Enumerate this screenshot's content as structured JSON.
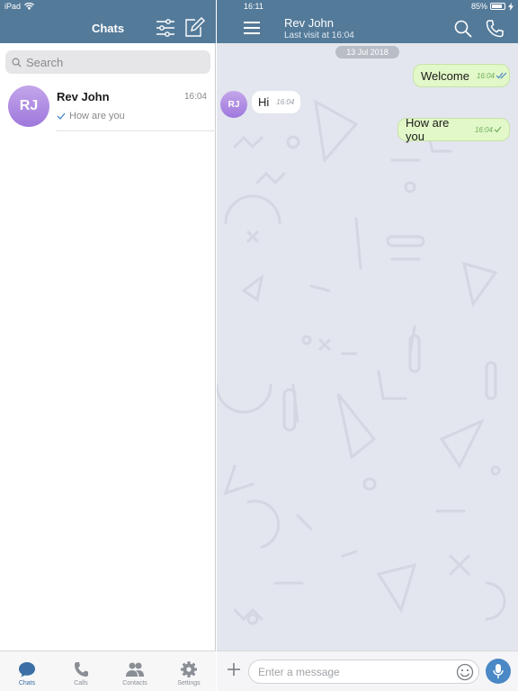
{
  "status_bar": {
    "device": "iPad",
    "time": "16:11",
    "battery": "85%",
    "battery_level": 0.85
  },
  "left_panel": {
    "title": "Chats",
    "search": {
      "placeholder": "Search"
    },
    "chats": [
      {
        "initials": "RJ",
        "name": "Rev John",
        "time": "16:04",
        "preview": "How are you"
      }
    ],
    "tabs": [
      {
        "label": "Chats",
        "icon": "chat-bubble-icon",
        "active": true
      },
      {
        "label": "Calls",
        "icon": "phone-icon"
      },
      {
        "label": "Contacts",
        "icon": "contacts-icon"
      },
      {
        "label": "Settings",
        "icon": "gear-icon"
      }
    ]
  },
  "conversation": {
    "peer_name": "Rev John",
    "peer_status": "Last visit at 16:04",
    "peer_initials": "RJ",
    "date_separator": "13 Jul 2018",
    "messages": [
      {
        "direction": "out",
        "text": "Welcome",
        "time": "16:04",
        "status": "read"
      },
      {
        "direction": "in",
        "text": "Hi",
        "time": "16:04"
      },
      {
        "direction": "out",
        "text": "How are you",
        "time": "16:04",
        "status": "sent"
      }
    ],
    "composer": {
      "placeholder": "Enter a message"
    }
  },
  "colors": {
    "header": "#547a99",
    "chat_background": "#e3e6ee",
    "outgoing_bubble": "#e2f8c8",
    "accent": "#4b88c6",
    "avatar": "#b28fe4"
  }
}
